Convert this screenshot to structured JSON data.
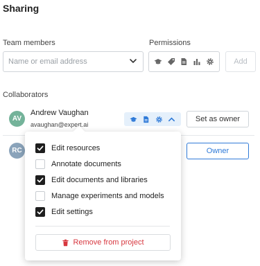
{
  "page": {
    "title": "Sharing"
  },
  "team": {
    "label": "Team members",
    "input_placeholder": "Name or email address"
  },
  "permissions": {
    "label": "Permissions",
    "icons": [
      "graduation-cap-icon",
      "tag-icon",
      "document-icon",
      "bar-chart-icon",
      "gear-icon"
    ],
    "add_label": "Add"
  },
  "collaborators": {
    "label": "Collaborators",
    "items": [
      {
        "initials": "AV",
        "name": "Andrew Vaughan",
        "email": "avaughan@expert.ai",
        "avatar_color": "#74b39a",
        "action_label": "Set as owner",
        "perm_icons": [
          "graduation-cap-icon",
          "document-icon",
          "gear-icon",
          "chevron-up-icon"
        ]
      },
      {
        "initials": "RC",
        "avatar_color": "#8aa3ba",
        "action_label": "Owner"
      }
    ]
  },
  "popup": {
    "options": [
      {
        "label": "Edit resources",
        "checked": true
      },
      {
        "label": "Annotate documents",
        "checked": false
      },
      {
        "label": "Edit documents and libraries",
        "checked": true
      },
      {
        "label": "Manage experiments and models",
        "checked": false
      },
      {
        "label": "Edit settings",
        "checked": true
      }
    ],
    "remove_label": "Remove from project"
  },
  "colors": {
    "accent": "#2f7ad8",
    "danger": "#d7373f",
    "chip_bg": "#e5f0fb"
  }
}
